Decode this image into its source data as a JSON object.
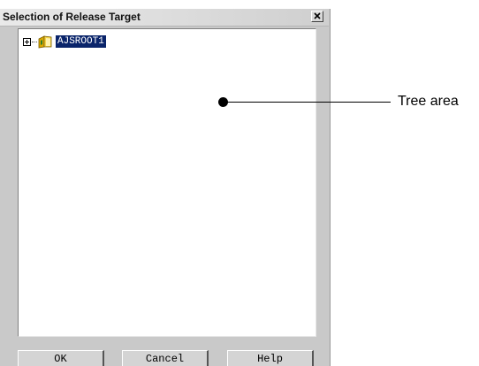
{
  "dialog": {
    "title": "Selection of Release Target",
    "close_glyph": "close-icon"
  },
  "tree": {
    "nodes": [
      {
        "label": "AJSROOT1",
        "expanded": false,
        "selected": true,
        "icon": "folder-icon",
        "expander": "plus-expand-icon"
      }
    ]
  },
  "buttons": {
    "ok": "OK",
    "cancel": "Cancel",
    "help": "Help"
  },
  "annotation": {
    "label": "Tree area"
  },
  "colors": {
    "selection_bg": "#0a246a",
    "selection_fg": "#ffffff",
    "dialog_bg": "#c9c9c9",
    "tree_bg": "#ffffff"
  }
}
